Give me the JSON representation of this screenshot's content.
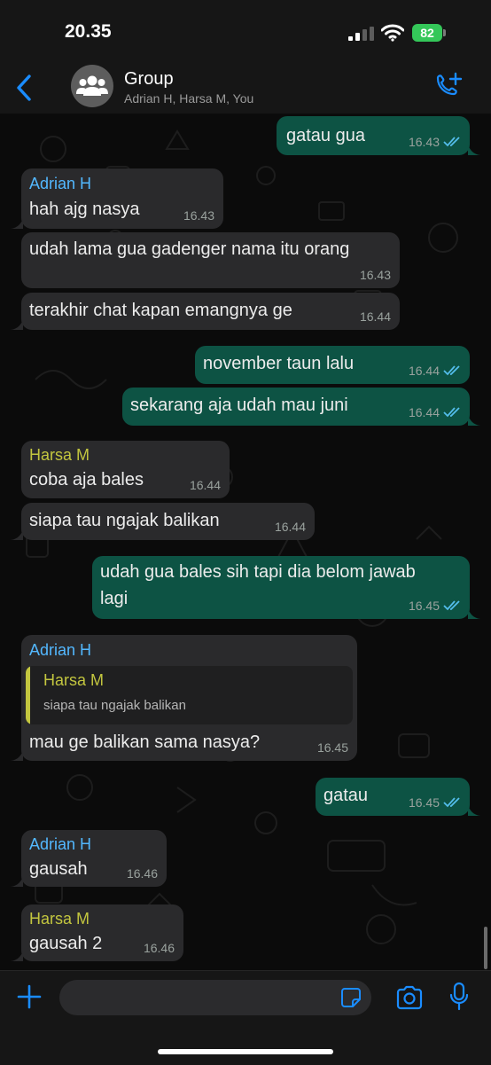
{
  "status_bar": {
    "time": "20.35",
    "battery": "82"
  },
  "header": {
    "title": "Group",
    "subtitle": "Adrian H, Harsa M, You"
  },
  "colors": {
    "outgoing_bubble": "#0d5344",
    "incoming_bubble": "#2a2a2c",
    "accent": "#1a8cff",
    "sender_adrian": "#53b8ff",
    "sender_harsa": "#c3c63f",
    "read_ticks": "#53bdeb"
  },
  "messages": [
    {
      "direction": "out",
      "text": "gatau gua",
      "time": "16.43",
      "status": "read"
    },
    {
      "direction": "in",
      "sender": "Adrian H",
      "text": "hah ajg nasya",
      "time": "16.43"
    },
    {
      "direction": "in",
      "text": "udah lama gua gadenger nama itu orang",
      "time": "16.43"
    },
    {
      "direction": "in",
      "text": "terakhir chat kapan emangnya ge",
      "time": "16.44"
    },
    {
      "direction": "out",
      "text": "november taun lalu",
      "time": "16.44",
      "status": "read"
    },
    {
      "direction": "out",
      "text": "sekarang aja udah mau juni",
      "time": "16.44",
      "status": "read"
    },
    {
      "direction": "in",
      "sender": "Harsa M",
      "text": "coba aja bales",
      "time": "16.44"
    },
    {
      "direction": "in",
      "text": "siapa tau ngajak balikan",
      "time": "16.44"
    },
    {
      "direction": "out",
      "text_lines": [
        "udah gua bales sih tapi dia belom jawab",
        "lagi"
      ],
      "time": "16.45",
      "status": "read"
    },
    {
      "direction": "in",
      "sender": "Adrian H",
      "quote": {
        "name": "Harsa M",
        "text": "siapa tau ngajak balikan"
      },
      "text": "mau ge balikan sama nasya?",
      "time": "16.45"
    },
    {
      "direction": "out",
      "text": "gatau",
      "time": "16.45",
      "status": "read"
    },
    {
      "direction": "in",
      "sender": "Adrian H",
      "text": "gausah",
      "time": "16.46"
    },
    {
      "direction": "in",
      "sender": "Harsa M",
      "text": "gausah 2",
      "time": "16.46"
    }
  ],
  "composer": {
    "value": "",
    "placeholder": ""
  }
}
